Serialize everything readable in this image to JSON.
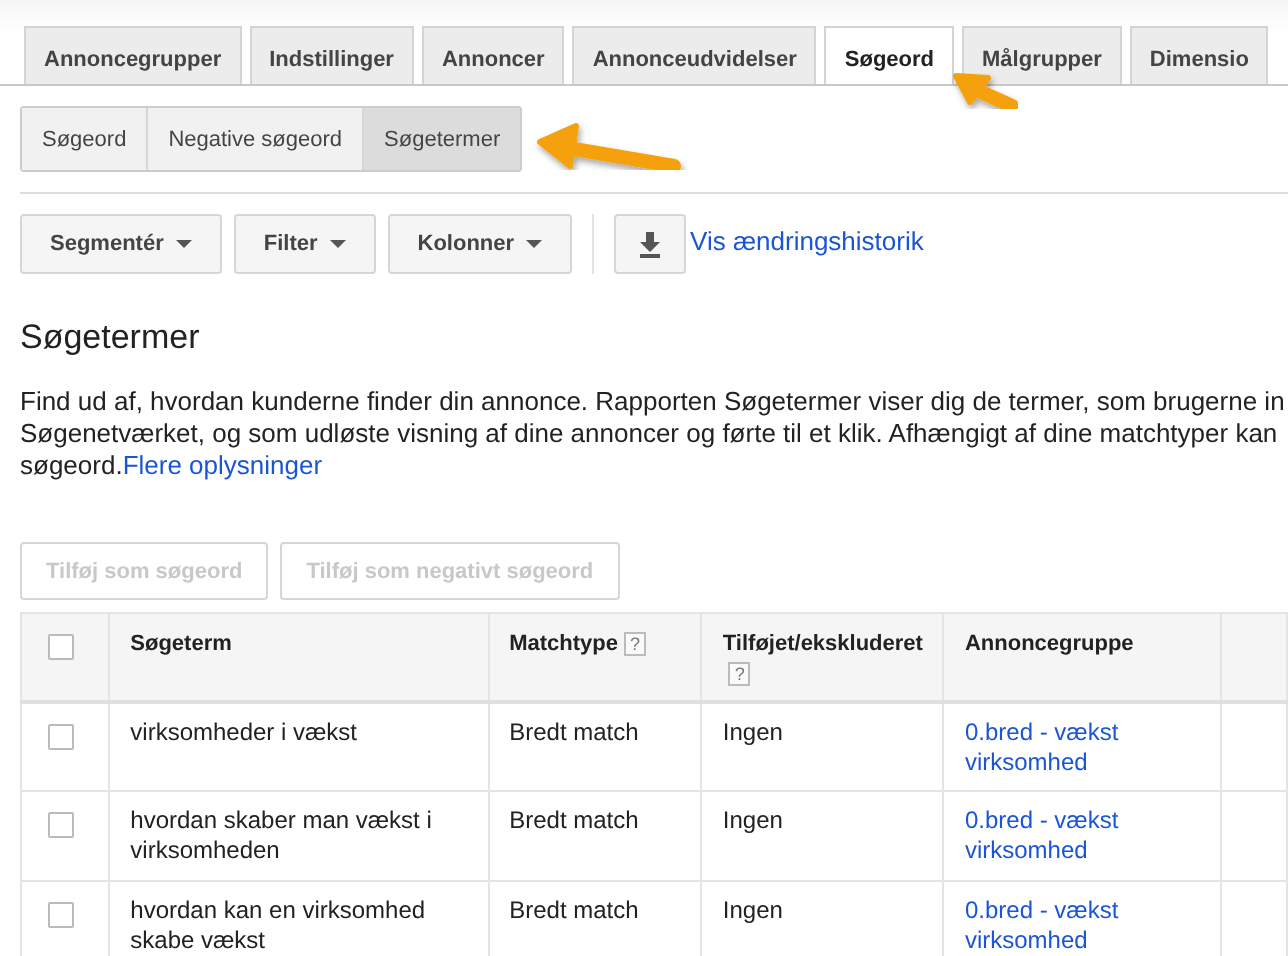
{
  "tabs": [
    {
      "label": "Annoncegrupper",
      "selected": false
    },
    {
      "label": "Indstillinger",
      "selected": false
    },
    {
      "label": "Annoncer",
      "selected": false
    },
    {
      "label": "Annonceudvidelser",
      "selected": false
    },
    {
      "label": "Søgeord",
      "selected": true
    },
    {
      "label": "Målgrupper",
      "selected": false
    },
    {
      "label": "Dimensio",
      "selected": false
    }
  ],
  "subtabs": [
    {
      "label": "Søgeord",
      "selected": false
    },
    {
      "label": "Negative søgeord",
      "selected": false
    },
    {
      "label": "Søgetermer",
      "selected": true
    }
  ],
  "toolbar": {
    "buttons": [
      {
        "label": "Segmentér",
        "kind": "dropdown"
      },
      {
        "label": "Filter",
        "kind": "dropdown"
      },
      {
        "label": "Kolonner",
        "kind": "dropdown"
      },
      {
        "kind": "download"
      }
    ],
    "link": "Vis ændringshistorik"
  },
  "heading": "Søgetermer",
  "description": {
    "lines": [
      "Find ud af, hvordan kunderne finder din annonce. Rapporten Søgetermer viser dig de termer, som brugerne in",
      "Søgenetværket, og som udløste visning af dine annoncer og førte til et klik. Afhængigt af dine matchtyper kan",
      "søgeord."
    ],
    "link": "Flere oplysninger"
  },
  "actions": [
    {
      "label": "Tilføj som søgeord",
      "disabled": true
    },
    {
      "label": "Tilføj som negativt søgeord",
      "disabled": true
    }
  ],
  "table": {
    "header_checked": false,
    "columns": [
      {
        "label": "Søgeterm"
      },
      {
        "label": "Matchtype",
        "help": "?"
      },
      {
        "label": "Tilføjet/ekskluderet",
        "help": "?"
      },
      {
        "label": "Annoncegruppe"
      }
    ],
    "rows": [
      {
        "checked": false,
        "cells": [
          "virksomheder i vækst",
          "Bredt match",
          "Ingen",
          "0.bred - vækst virksomhed"
        ]
      },
      {
        "checked": false,
        "cells": [
          "hvordan skaber man vækst i virksomheden",
          "Bredt match",
          "Ingen",
          "0.bred - vækst virksomhed"
        ]
      },
      {
        "checked": false,
        "cells": [
          "hvordan kan en virksomhed skabe vækst",
          "Bredt match",
          "Ingen",
          "0.bred - vækst virksomhed"
        ]
      }
    ]
  }
}
